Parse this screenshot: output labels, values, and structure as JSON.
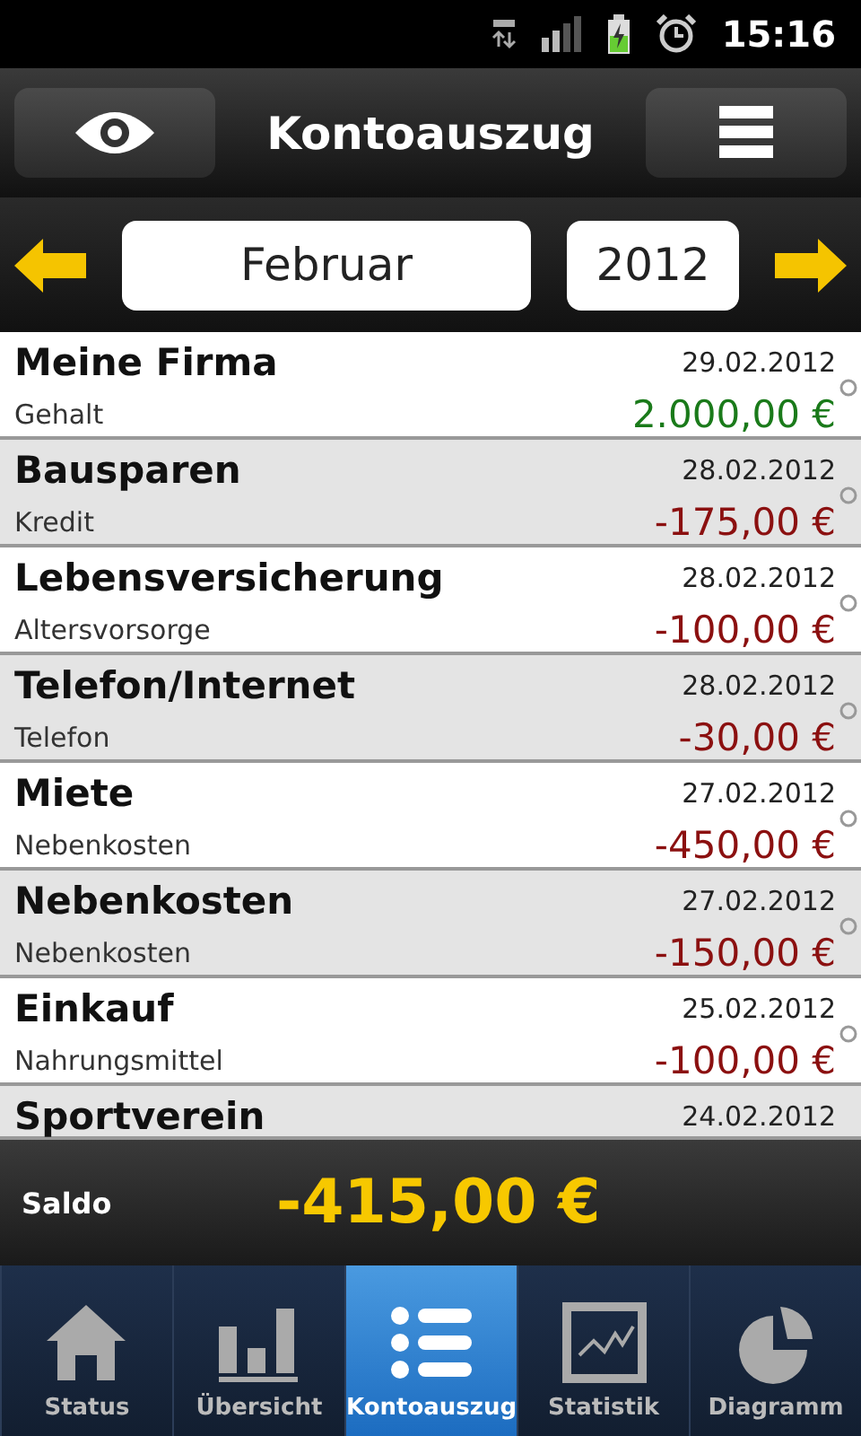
{
  "status_bar": {
    "time": "15:16"
  },
  "header": {
    "title": "Kontoauszug"
  },
  "period": {
    "month": "Februar",
    "year": "2012"
  },
  "transactions": [
    {
      "payee": "Meine Firma",
      "category": "Gehalt",
      "date": "29.02.2012",
      "amount": "2.000,00 €",
      "kind": "income"
    },
    {
      "payee": "Bausparen",
      "category": "Kredit",
      "date": "28.02.2012",
      "amount": "-175,00 €",
      "kind": "expense"
    },
    {
      "payee": "Lebensversicherung",
      "category": "Altersvorsorge",
      "date": "28.02.2012",
      "amount": "-100,00 €",
      "kind": "expense"
    },
    {
      "payee": "Telefon/Internet",
      "category": "Telefon",
      "date": "28.02.2012",
      "amount": "-30,00 €",
      "kind": "expense"
    },
    {
      "payee": "Miete",
      "category": "Nebenkosten",
      "date": "27.02.2012",
      "amount": "-450,00 €",
      "kind": "expense"
    },
    {
      "payee": "Nebenkosten",
      "category": "Nebenkosten",
      "date": "27.02.2012",
      "amount": "-150,00 €",
      "kind": "expense"
    },
    {
      "payee": "Einkauf",
      "category": "Nahrungsmittel",
      "date": "25.02.2012",
      "amount": "-100,00 €",
      "kind": "expense"
    },
    {
      "payee": "Sportverein",
      "date": "24.02.2012",
      "kind": "partial"
    }
  ],
  "balance": {
    "label": "Saldo",
    "amount": "-415,00 €"
  },
  "tabs": [
    {
      "label": "Status",
      "kind": "home",
      "selected": false
    },
    {
      "label": "Übersicht",
      "kind": "bars",
      "selected": false
    },
    {
      "label": "Kontoauszug",
      "kind": "list",
      "selected": true
    },
    {
      "label": "Statistik",
      "kind": "chart",
      "selected": false
    },
    {
      "label": "Diagramm",
      "kind": "pie",
      "selected": false
    }
  ]
}
